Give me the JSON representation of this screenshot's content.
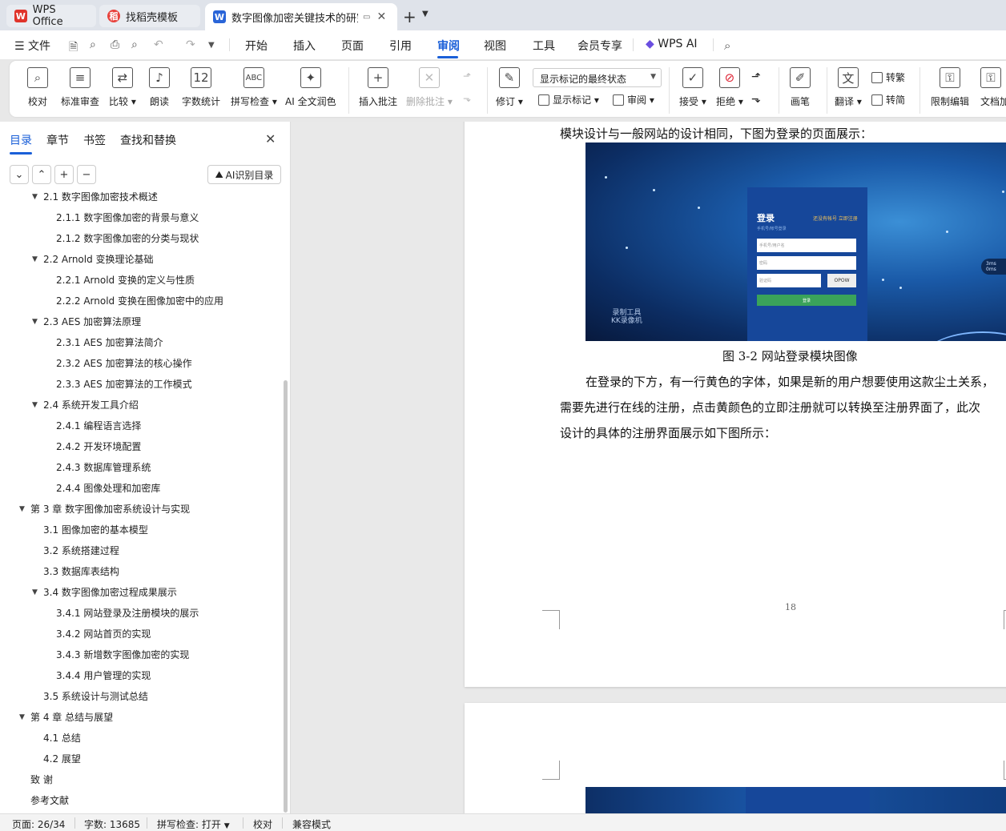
{
  "tabs": [
    {
      "label": "WPS Office",
      "icon": "wps-logo-icon",
      "color": "#e0342b"
    },
    {
      "label": "找稻壳模板",
      "icon": "docer-logo-icon",
      "color": "#e8423c"
    },
    {
      "label": "数字图像加密关键技术的研究",
      "icon": "word-doc-icon",
      "color": "#2a65d8"
    }
  ],
  "menu": {
    "file": "文件",
    "items": [
      "开始",
      "插入",
      "页面",
      "引用",
      "审阅",
      "视图",
      "工具",
      "会员专享"
    ],
    "active": "审阅",
    "wps_ai": "WPS AI"
  },
  "ribbon": {
    "proofread": "校对",
    "std_review": "标准审查",
    "compare": "比较",
    "read_aloud": "朗读",
    "word_count": "字数统计",
    "spell_check": "拼写检查",
    "ai_polish": "AI 全文润色",
    "insert_comment": "插入批注",
    "delete_comment": "删除批注",
    "track_changes": "修订",
    "display_select": "显示标记的最终状态",
    "show_markup": "显示标记",
    "review": "审阅",
    "accept": "接受",
    "reject": "拒绝",
    "pen": "画笔",
    "translate": "翻译",
    "to_traditional": "转繁",
    "to_simplified": "转简",
    "restrict_edit": "限制编辑",
    "doc_encrypt": "文档加"
  },
  "panel": {
    "tabs": [
      "目录",
      "章节",
      "书签",
      "查找和替换"
    ],
    "active_tab": "目录",
    "ai_toc": "AI识别目录",
    "toc": [
      {
        "text": "2.1  数字图像加密技术概述",
        "level": 2,
        "caret": true
      },
      {
        "text": "2.1.1  数字图像加密的背景与意义",
        "level": 3
      },
      {
        "text": "2.1.2  数字图像加密的分类与现状",
        "level": 3
      },
      {
        "text": "2.2 Arnold 变换理论基础",
        "level": 2,
        "caret": true
      },
      {
        "text": "2.2.1 Arnold 变换的定义与性质",
        "level": 3
      },
      {
        "text": "2.2.2 Arnold 变换在图像加密中的应用",
        "level": 3
      },
      {
        "text": "2.3 AES 加密算法原理",
        "level": 2,
        "caret": true
      },
      {
        "text": "2.3.1 AES 加密算法简介",
        "level": 3
      },
      {
        "text": "2.3.2 AES 加密算法的核心操作",
        "level": 3
      },
      {
        "text": "2.3.3 AES 加密算法的工作模式",
        "level": 3
      },
      {
        "text": "2.4  系统开发工具介绍",
        "level": 2,
        "caret": true
      },
      {
        "text": "2.4.1  编程语言选择",
        "level": 3
      },
      {
        "text": "2.4.2  开发环境配置",
        "level": 3
      },
      {
        "text": "2.4.3  数据库管理系统",
        "level": 3
      },
      {
        "text": "2.4.4  图像处理和加密库",
        "level": 3
      },
      {
        "text": "第 3 章  数字图像加密系统设计与实现",
        "level": 1,
        "caret": true
      },
      {
        "text": "3.1  图像加密的基本模型",
        "level": 2
      },
      {
        "text": "3.2  系统搭建过程",
        "level": 2
      },
      {
        "text": "3.3  数据库表结构",
        "level": 2
      },
      {
        "text": "3.4  数字图像加密过程成果展示",
        "level": 2,
        "caret": true
      },
      {
        "text": "3.4.1 网站登录及注册模块的展示",
        "level": 3
      },
      {
        "text": "3.4.2 网站首页的实现",
        "level": 3
      },
      {
        "text": "3.4.3 新增数字图像加密的实现",
        "level": 3
      },
      {
        "text": "3.4.4 用户管理的实现",
        "level": 3
      },
      {
        "text": "3.5 系统设计与测试总结",
        "level": 2
      },
      {
        "text": "第 4 章  总结与展望",
        "level": 1,
        "caret": true
      },
      {
        "text": "4.1  总结",
        "level": 2
      },
      {
        "text": "4.2  展望",
        "level": 2
      },
      {
        "text": "致    谢",
        "level": 1
      },
      {
        "text": "参考文献",
        "level": 1
      }
    ]
  },
  "document": {
    "line_top": "模块设计与一般网站的设计相同，下图为登录的页面展示：",
    "figure_caption": "图 3-2  网站登录模块图像",
    "para_line1": "在登录的下方，有一行黄色的字体，如果是新的用户想要使用这款尘土关系，",
    "para_line2": "需要先进行在线的注册，点击黄颜色的立即注册就可以转换至注册界面了，此次",
    "para_line3": "设计的具体的注册界面展示如下图所示：",
    "page_number": "18",
    "image": {
      "title": "登录",
      "register": "还没有帐号  立即注册",
      "subtitle": "手机号/帐号登录",
      "field_user": "手机号/用户名",
      "field_pwd": "密码",
      "field_captcha": "验证码",
      "captcha": "OPOW",
      "login_btn": "登录",
      "watermark_1": "录制工具",
      "watermark_2": "KK录像机",
      "side_1": "3ms",
      "side_2": "0ms"
    }
  },
  "status": {
    "page": "页面: 26/34",
    "words": "字数: 13685",
    "spell": "拼写检查: 打开",
    "proof": "校对",
    "compat": "兼容模式"
  },
  "colors": {
    "accent": "#1a5fd8"
  }
}
